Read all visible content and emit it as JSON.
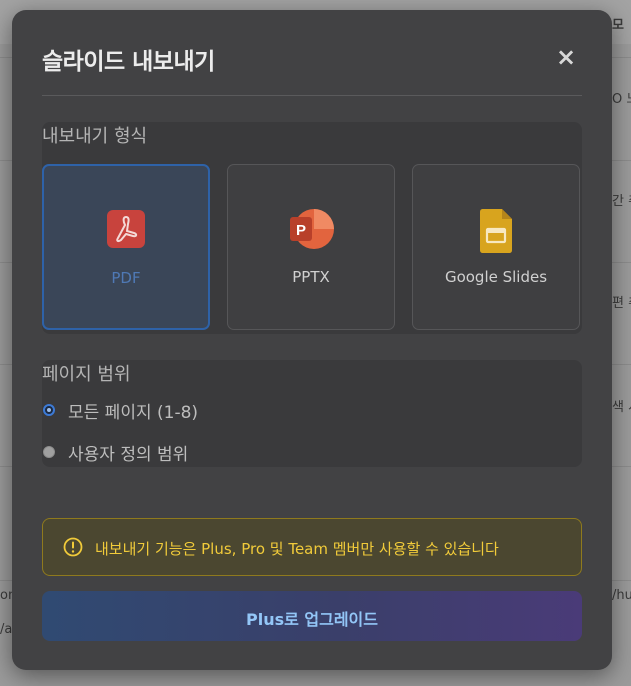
{
  "background": {
    "header_fragment": "모",
    "fragments": [
      "O 노",
      "간 취",
      "편 취",
      "색 시",
      "om",
      "/hu",
      "/a"
    ]
  },
  "modal": {
    "title": "슬라이드 내보내기",
    "close_symbol": "×",
    "export_format": {
      "label": "내보내기 형식",
      "selected": "PDF",
      "options": [
        {
          "label": "PDF",
          "icon": "pdf-icon",
          "color": "#c8433d"
        },
        {
          "label": "PPTX",
          "icon": "powerpoint-icon",
          "color": "#d65a38"
        },
        {
          "label": "Google Slides",
          "icon": "google-slides-icon",
          "color": "#d8a41e"
        }
      ]
    },
    "page_range": {
      "label": "페이지 범위",
      "options": [
        {
          "label": "모든 페이지 (1-8)",
          "selected": true
        },
        {
          "label": "사용자 정의 범위",
          "selected": false
        }
      ]
    },
    "warning": {
      "icon": "warning-icon",
      "text": "내보내기 기능은 Plus, Pro 및 Team 멤버만 사용할 수 있습니다"
    },
    "upgrade_button": {
      "label": "Plus로 업그레이드"
    }
  }
}
